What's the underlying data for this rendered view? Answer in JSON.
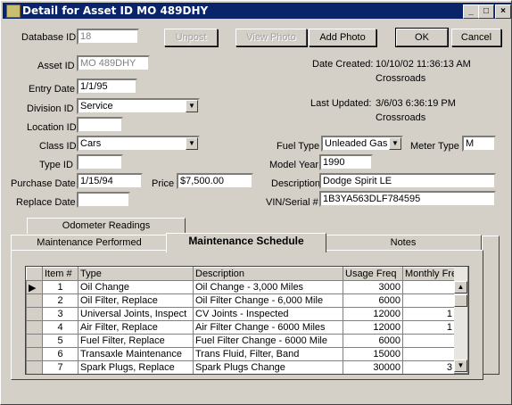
{
  "window": {
    "title": "Detail for Asset ID MO 489DHY"
  },
  "buttons": {
    "unpost": "Unpost",
    "view_photo": "View Photo",
    "add_photo": "Add Photo",
    "ok": "OK",
    "cancel": "Cancel"
  },
  "fields": {
    "database_id": {
      "label": "Database ID",
      "value": "18"
    },
    "asset_id": {
      "label": "Asset ID",
      "value": "MO 489DHY"
    },
    "entry_date": {
      "label": "Entry Date",
      "value": "1/1/95"
    },
    "division_id": {
      "label": "Division ID",
      "value": "Service"
    },
    "location_id": {
      "label": "Location ID",
      "value": ""
    },
    "class_id": {
      "label": "Class ID",
      "value": "Cars"
    },
    "type_id": {
      "label": "Type ID",
      "value": ""
    },
    "purchase_date": {
      "label": "Purchase Date",
      "value": "1/15/94"
    },
    "price": {
      "label": "Price",
      "value": "$7,500.00"
    },
    "replace_date": {
      "label": "Replace Date",
      "value": ""
    },
    "fuel_type": {
      "label": "Fuel Type",
      "value": "Unleaded Gas"
    },
    "meter_type": {
      "label": "Meter Type",
      "value": "M"
    },
    "model_year": {
      "label": "Model Year",
      "value": "1990"
    },
    "description": {
      "label": "Description",
      "value": "Dodge Spirit LE"
    },
    "vin_serial": {
      "label": "VIN/Serial #",
      "value": "1B3YA563DLF784595"
    }
  },
  "dates": {
    "created_label": "Date Created:",
    "created_value": "10/10/02 11:36:13 AM",
    "created_by": "Crossroads",
    "updated_label": "Last Updated:",
    "updated_value": "3/6/03 6:36:19 PM",
    "updated_by": "Crossroads"
  },
  "tabs": {
    "odometer": "Odometer Readings",
    "maint_performed": "Maintenance Performed",
    "maint_schedule": "Maintenance Schedule",
    "notes": "Notes"
  },
  "grid": {
    "headers": [
      "Item #",
      "Type",
      "Description",
      "Usage Freq",
      "Monthly Fre"
    ],
    "rows": [
      {
        "item": "1",
        "type": "Oil Change",
        "description": "Oil Change - 3,000 Miles",
        "usage": "3000",
        "monthly": ""
      },
      {
        "item": "2",
        "type": "Oil Filter, Replace",
        "description": "Oil Filter Change - 6,000 Mile",
        "usage": "6000",
        "monthly": ""
      },
      {
        "item": "3",
        "type": "Universal Joints, Inspect",
        "description": "CV Joints - Inspected",
        "usage": "12000",
        "monthly": "1"
      },
      {
        "item": "4",
        "type": "Air Filter, Replace",
        "description": "Air Filter Change - 6000 Miles",
        "usage": "12000",
        "monthly": "1"
      },
      {
        "item": "5",
        "type": "Fuel Filter, Replace",
        "description": "Fuel Filter Change - 6000 Mile",
        "usage": "6000",
        "monthly": ""
      },
      {
        "item": "6",
        "type": "Transaxle Maintenance",
        "description": "Trans Fluid, Filter, Band",
        "usage": "15000",
        "monthly": ""
      },
      {
        "item": "7",
        "type": "Spark Plugs, Replace",
        "description": "Spark Plugs Change",
        "usage": "30000",
        "monthly": "3"
      }
    ]
  }
}
